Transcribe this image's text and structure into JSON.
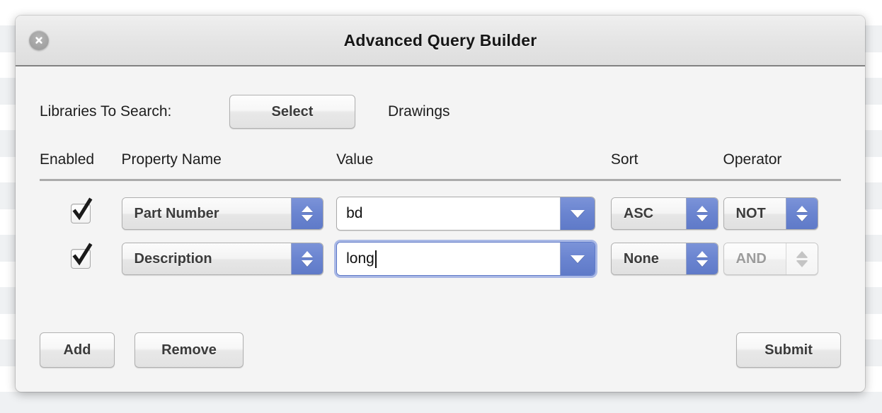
{
  "window": {
    "title": "Advanced Query Builder",
    "close_icon": "close-circle-icon"
  },
  "libraries": {
    "label": "Libraries To Search:",
    "select_button": "Select",
    "selected": "Drawings"
  },
  "table": {
    "headers": {
      "enabled": "Enabled",
      "property_name": "Property Name",
      "value": "Value",
      "sort": "Sort",
      "operator": "Operator"
    },
    "rows": [
      {
        "enabled": true,
        "property_name": "Part Number",
        "value": "bd",
        "value_focused": false,
        "sort": "ASC",
        "operator": "NOT",
        "operator_disabled": false
      },
      {
        "enabled": true,
        "property_name": "Description",
        "value": "long",
        "value_focused": true,
        "sort": "None",
        "operator": "AND",
        "operator_disabled": true
      }
    ]
  },
  "footer": {
    "add": "Add",
    "remove": "Remove",
    "submit": "Submit"
  },
  "colors": {
    "accent_blue": "#6a84d0",
    "window_bg": "#f4f4f4",
    "titlebar_bg": "#e4e4e4",
    "separator": "#ababab",
    "disabled_text": "#9c9c9c"
  }
}
